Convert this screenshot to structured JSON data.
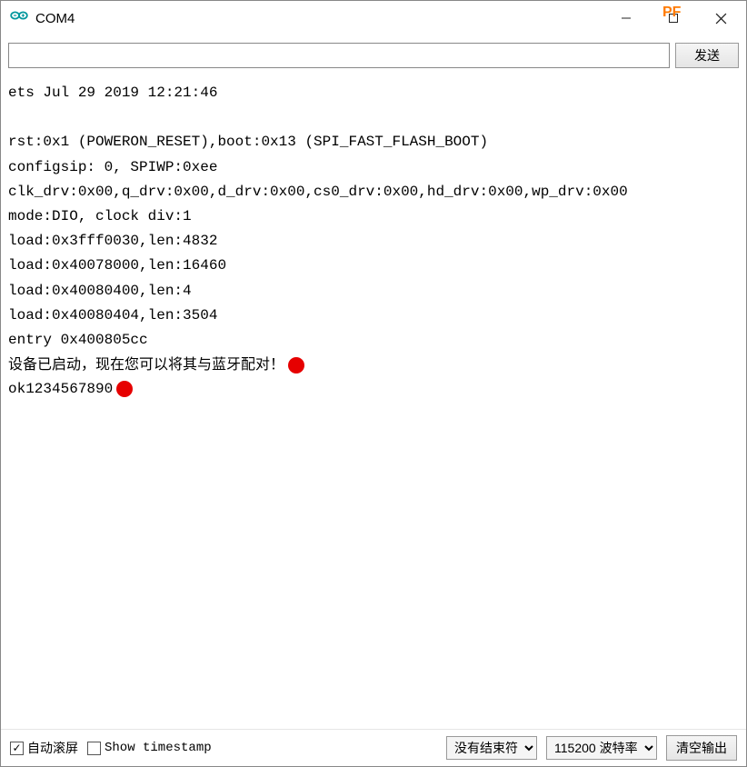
{
  "window": {
    "title": "COM4"
  },
  "toolbar": {
    "send_label": "发送"
  },
  "console_lines": [
    "ets Jul 29 2019 12:21:46",
    "",
    "rst:0x1 (POWERON_RESET),boot:0x13 (SPI_FAST_FLASH_BOOT)",
    "configsip: 0, SPIWP:0xee",
    "clk_drv:0x00,q_drv:0x00,d_drv:0x00,cs0_drv:0x00,hd_drv:0x00,wp_drv:0x00",
    "mode:DIO, clock div:1",
    "load:0x3fff0030,len:4832",
    "load:0x40078000,len:16460",
    "load:0x40080400,len:4",
    "load:0x40080404,len:3504",
    "entry 0x400805cc"
  ],
  "console_marked_lines": [
    {
      "text": "设备已启动，现在您可以将其与蓝牙配对！",
      "chinese": true
    },
    {
      "text": "ok1234567890",
      "chinese": false
    }
  ],
  "bottombar": {
    "autoscroll_label": "自动滚屏",
    "autoscroll_checked": true,
    "timestamp_label": "Show timestamp",
    "timestamp_checked": false,
    "line_ending_options": [
      "没有结束符"
    ],
    "line_ending_selected": "没有结束符",
    "baud_options": [
      "115200 波特率"
    ],
    "baud_selected": "115200 波特率",
    "clear_label": "清空输出"
  }
}
